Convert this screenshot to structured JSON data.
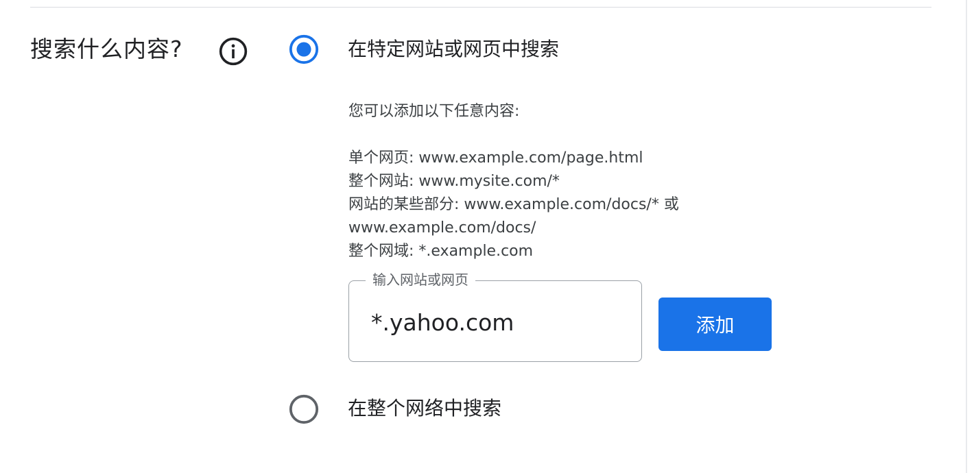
{
  "section": {
    "title": "搜索什么内容?",
    "info_icon": "info-icon"
  },
  "options": {
    "site": {
      "label": "在特定网站或网页中搜索",
      "selected": true
    },
    "web": {
      "label": "在整个网络中搜索",
      "selected": false
    }
  },
  "help": {
    "intro": "您可以添加以下任意内容:",
    "lines": [
      "单个网页: www.example.com/page.html",
      "整个网站: www.mysite.com/*",
      "网站的某些部分: www.example.com/docs/* 或",
      "www.example.com/docs/",
      "整个网域: *.example.com"
    ]
  },
  "input": {
    "label": "输入网站或网页",
    "value": "*.yahoo.com"
  },
  "add_button": {
    "label": "添加"
  },
  "colors": {
    "accent": "#1a73e8",
    "text": "#202124",
    "secondary_text": "#3c4043",
    "border": "#9aa0a6"
  }
}
